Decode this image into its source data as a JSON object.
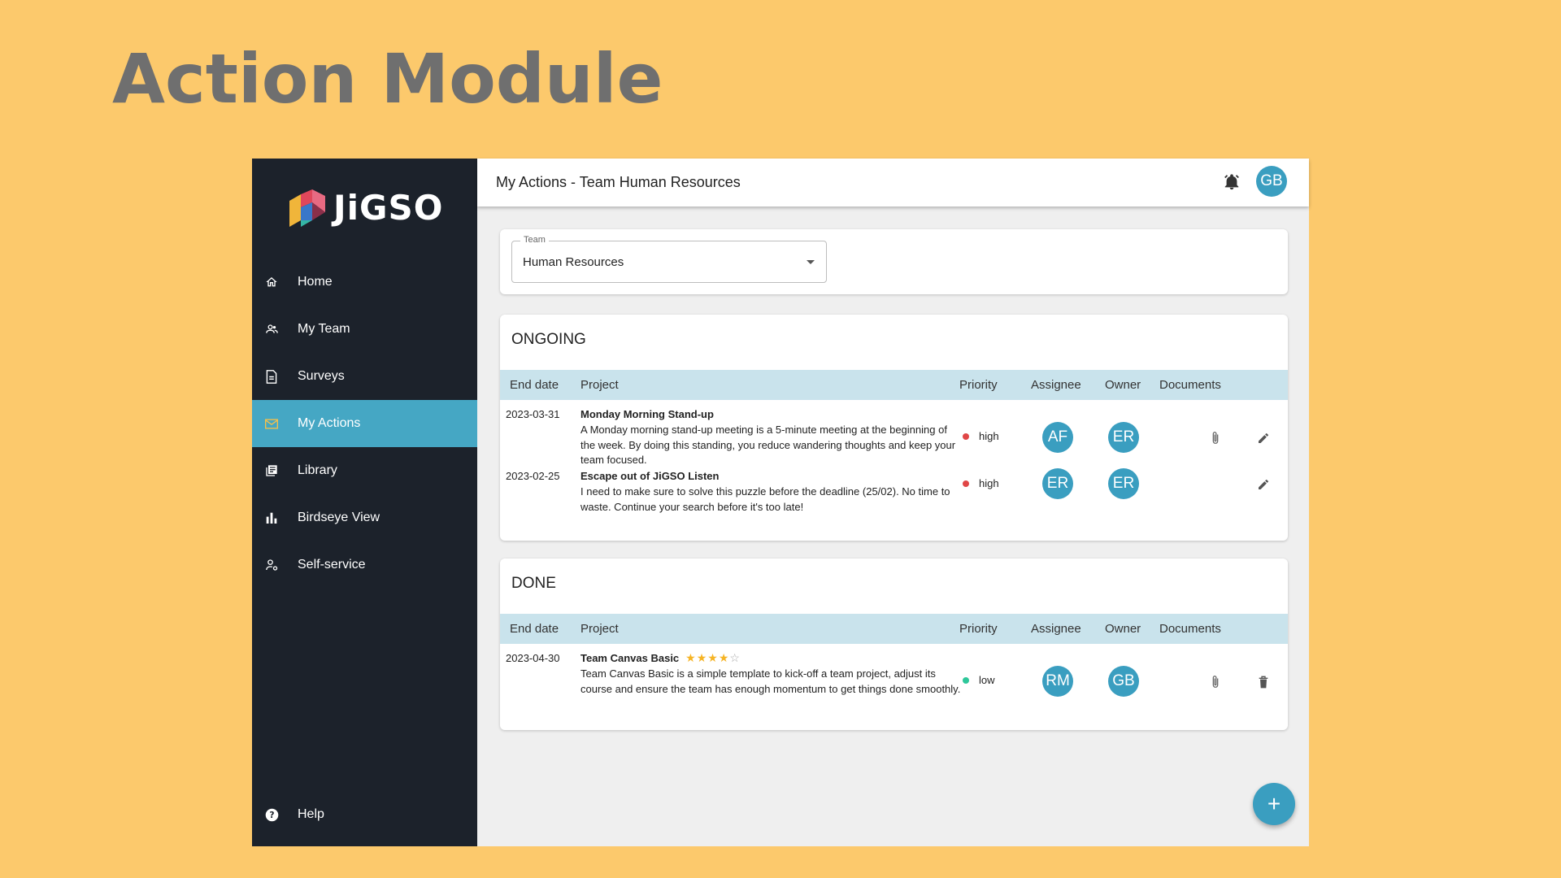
{
  "slide": {
    "title": "Action Module"
  },
  "brand": {
    "name": "JiGSO"
  },
  "sidebar": {
    "items": [
      {
        "label": "Home",
        "icon": "home-icon"
      },
      {
        "label": "My Team",
        "icon": "team-icon"
      },
      {
        "label": "Surveys",
        "icon": "document-icon"
      },
      {
        "label": "My Actions",
        "icon": "mail-icon",
        "active": true
      },
      {
        "label": "Library",
        "icon": "library-icon"
      },
      {
        "label": "Birdseye View",
        "icon": "bar-chart-icon"
      },
      {
        "label": "Self-service",
        "icon": "user-settings-icon"
      }
    ],
    "help": {
      "label": "Help",
      "icon": "help-icon"
    }
  },
  "topbar": {
    "title": "My Actions - Team Human Resources",
    "avatar": "GB"
  },
  "team_filter": {
    "label": "Team",
    "value": "Human Resources"
  },
  "columns": {
    "end_date": "End date",
    "project": "Project",
    "priority": "Priority",
    "assignee": "Assignee",
    "owner": "Owner",
    "documents": "Documents"
  },
  "ongoing": {
    "title": "ONGOING",
    "rows": [
      {
        "end_date": "2023-03-31",
        "project": "Monday Morning Stand-up",
        "description": "A Monday morning stand-up meeting is a 5-minute meeting at the beginning of the week. By doing this standing, you reduce wandering thoughts and keep your team focused.",
        "priority": "high",
        "assignee": "AF",
        "owner": "ER",
        "has_document": true
      },
      {
        "end_date": "2023-02-25",
        "project": "Escape out of JiGSO Listen",
        "description": "I need to make sure to solve this puzzle before the deadline (25/02). No time to waste. Continue your search before it's too late!",
        "priority": "high",
        "assignee": "ER",
        "owner": "ER",
        "has_document": false
      }
    ]
  },
  "done": {
    "title": "DONE",
    "rows": [
      {
        "end_date": "2023-04-30",
        "project": "Team Canvas Basic",
        "rating": 4,
        "rating_max": 5,
        "description": "Team Canvas Basic is a simple template to kick-off a team project, adjust its course and ensure the team has enough momentum to get things done smoothly.",
        "priority": "low",
        "assignee": "RM",
        "owner": "GB",
        "has_document": true
      }
    ]
  },
  "fab": {
    "label": "+"
  },
  "colors": {
    "background": "#fcc96c",
    "sidebar": "#1c222b",
    "accent": "#45a7c4",
    "avatar": "#3a9ec0",
    "table_header": "#c9e3ec",
    "priority_high": "#e04646",
    "priority_low": "#2ec79a",
    "star": "#f6b425"
  }
}
